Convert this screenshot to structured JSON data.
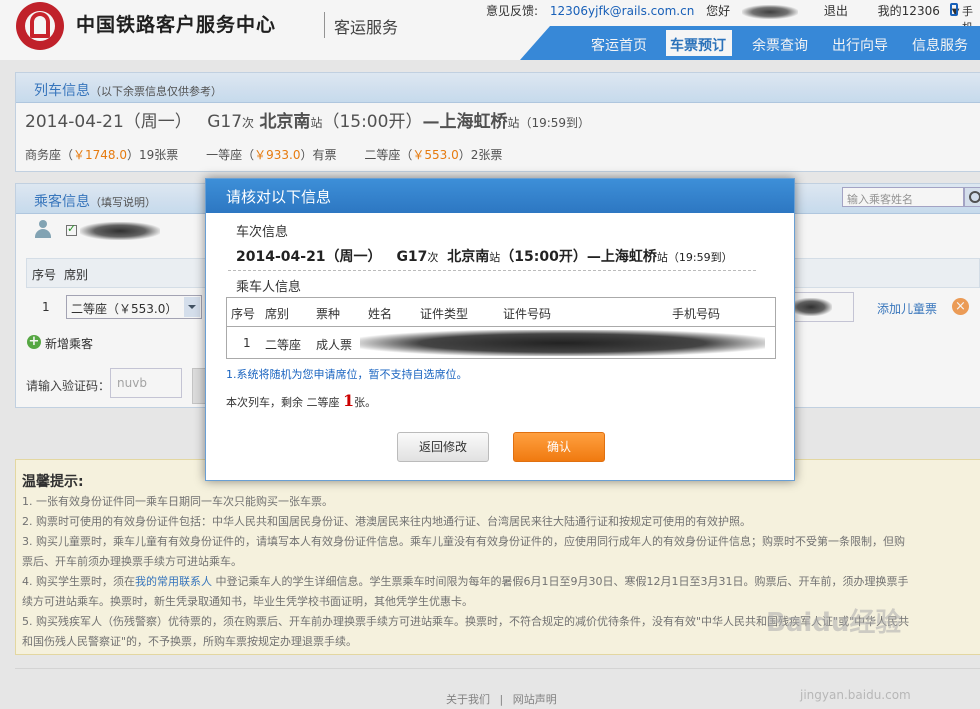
{
  "header": {
    "logo_title": "中国铁路客户服务中心",
    "logo_sub": "客运服务",
    "feedback_label": "意见反馈:",
    "feedback_email": "12306yjfk@rails.com.cn",
    "greeting": "您好",
    "logout": "退出",
    "my12306": "我的12306",
    "phone": "手机"
  },
  "nav": {
    "items": [
      "客运首页",
      "车票预订",
      "余票查询",
      "出行向导",
      "信息服务"
    ],
    "active": "车票预订"
  },
  "train_panel": {
    "title": "列车信息",
    "subtitle": "（以下余票信息仅供参考）",
    "date": "2014-04-21（周一）",
    "train_no": "G17",
    "train_suffix": "次",
    "from": "北京南",
    "station_suffix": "站",
    "depart": "（15:00开）",
    "to_prefix": "—上海虹桥",
    "arrive": "（19:59到）",
    "seats": [
      {
        "name": "商务座（",
        "price": "￥1748.0",
        "count": "）19张票"
      },
      {
        "name": "一等座（",
        "price": "￥933.0",
        "count": "）有票"
      },
      {
        "name": "二等座（",
        "price": "￥553.0",
        "count": "）2张票"
      }
    ]
  },
  "passenger_panel": {
    "title": "乘客信息",
    "subtitle": "（填写说明）",
    "search_placeholder": "输入乘客姓名",
    "col_seq": "序号",
    "col_seat": "席别",
    "row_seq": "1",
    "seat_value": "二等座（￥553.0）",
    "add_child": "添加儿童票",
    "add_passenger": "新增乘客",
    "captcha_label": "请输入验证码：",
    "captcha_value": "nuvb"
  },
  "dialog": {
    "title": "请核对以下信息",
    "section_train": "车次信息",
    "train_date": "2014-04-21（周一）",
    "train_no": "G17",
    "train_suffix": "次",
    "from": "北京南",
    "station_suffix": "站",
    "depart": "（15:00开）",
    "to_prefix": "—上海虹桥",
    "arrive": "（19:59到）",
    "section_passenger": "乘车人信息",
    "headers": [
      "序号",
      "席别",
      "票种",
      "姓名",
      "证件类型",
      "证件号码",
      "手机号码"
    ],
    "row": {
      "seq": "1",
      "seat": "二等座",
      "ticket_type": "成人票"
    },
    "note": "1.系统将随机为您申请席位，暂不支持自选席位。",
    "remain_prefix": "本次列车，剩余 二等座",
    "remain_count": "1",
    "remain_suffix": "张。",
    "back_label": "返回修改",
    "confirm_label": "确认"
  },
  "tips": {
    "title": "温馨提示:",
    "lines": [
      "1. 一张有效身份证件同一乘车日期同一车次只能购买一张车票。",
      "2. 购票时可使用的有效身份证件包括：中华人民共和国居民身份证、港澳居民来往内地通行证、台湾居民来往大陆通行证和按规定可使用的有效护照。",
      "3. 购买儿童票时，乘车儿童有有效身份证件的，请填写本人有效身份证件信息。乘车儿童没有有效身份证件的，应使用同行成年人的有效身份证件信息；购票时不受第一条限制，但购",
      "票后、开车前须办理换票手续方可进站乘车。",
      "4. 购买学生票时，须在",
      "我的常用联系人",
      " 中登记乘车人的学生详细信息。学生票乘车时间限为每年的暑假6月1日至9月30日、寒假12月1日至3月31日。购票后、开车前，须办理换票手",
      "续方可进站乘车。换票时，新生凭录取通知书，毕业生凭学校书面证明，其他凭学生优惠卡。",
      "5. 购买残疾军人（伤残警察）优待票的，须在购票后、开车前办理换票手续方可进站乘车。换票时，不符合规定的减价优待条件，没有有效\"中华人民共和国残疾军人证\"或\"中华人民共",
      "和国伤残人民警察证\"的，不予换票，所购车票按规定办理退票手续。"
    ]
  },
  "footer": {
    "about": "关于我们",
    "sep": "|",
    "statement": "网站声明"
  },
  "watermark": {
    "main": "Baidu经验",
    "sub": "jingyan.baidu.com"
  },
  "colors": {
    "nav_blue": "#3a8ee0",
    "dialog_head": "#2d77c2",
    "confirm_orange": "#f07a10",
    "price_orange": "#f08010",
    "link_blue": "#1a64c0"
  }
}
